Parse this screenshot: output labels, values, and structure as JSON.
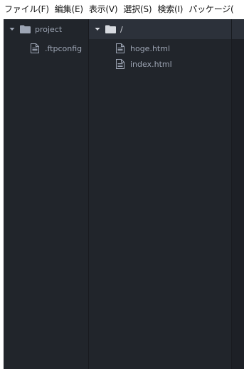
{
  "menubar": {
    "items": [
      {
        "label": "ファイル(F)"
      },
      {
        "label": "編集(E)"
      },
      {
        "label": "表示(V)"
      },
      {
        "label": "選択(S)"
      },
      {
        "label": "検索(I)"
      },
      {
        "label": "パッケージ("
      }
    ]
  },
  "left_pane": {
    "folder_label": "project",
    "folder_icon": "folder-icon",
    "expanded": true,
    "files": [
      {
        "label": ".ftpconfig",
        "icon": "file-text-icon"
      }
    ]
  },
  "right_pane": {
    "folder_label": "/",
    "folder_icon": "folder-icon",
    "expanded": true,
    "files": [
      {
        "label": "hoge.html",
        "icon": "file-text-icon"
      },
      {
        "label": "index.html",
        "icon": "file-text-icon"
      }
    ]
  },
  "colors": {
    "background": "#21252b",
    "header_active": "#2c313a",
    "text": "#9da5b4",
    "text_bright": "#d7dae0"
  }
}
